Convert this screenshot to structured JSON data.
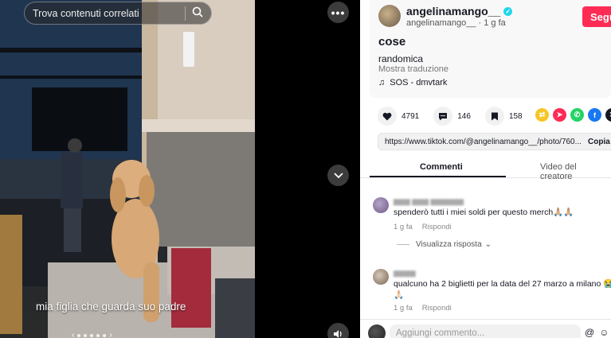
{
  "media": {
    "search_placeholder": "Trova contenuti correlati",
    "caption": "mia figlia che guarda suo padre",
    "icons": {
      "search": "search-icon",
      "more": "more-icon",
      "down": "chevron-down-icon",
      "volume": "volume-icon"
    }
  },
  "post": {
    "username": "angelinamango__",
    "handle": "angelinamango__",
    "time": "· 1 g fa",
    "follow_label": "Segui",
    "title": "cose",
    "text": "randomica",
    "translate_label": "Mostra traduzione",
    "music": "SOS - dmvtark"
  },
  "stats": {
    "likes": "4791",
    "comments": "146",
    "saves": "158"
  },
  "share": {
    "url": "https://www.tiktok.com/@angelinamango__/photo/760...",
    "copy_label": "Copia",
    "colors": {
      "repost": "#f7c626",
      "send": "#fe2c55",
      "whatsapp": "#25d366",
      "facebook": "#1877f2",
      "x": "#161823"
    }
  },
  "tabs": {
    "comments": "Commenti",
    "creator_videos": "Video del creatore"
  },
  "comments": [
    {
      "text": "spenderò tutti i miei soldi per questo merch🙏🏼🙏🏼",
      "time": "1 g fa",
      "reply_label": "Rispondi",
      "view_replies": "Visualizza risposta"
    },
    {
      "text": "qualcuno ha 2 biglietti per la data del 27 marzo a milano 😭",
      "text_2": "🙏🏻",
      "time": "1 g fa",
      "reply_label": "Rispondi"
    }
  ],
  "composer": {
    "placeholder": "Aggiungi commento..."
  }
}
